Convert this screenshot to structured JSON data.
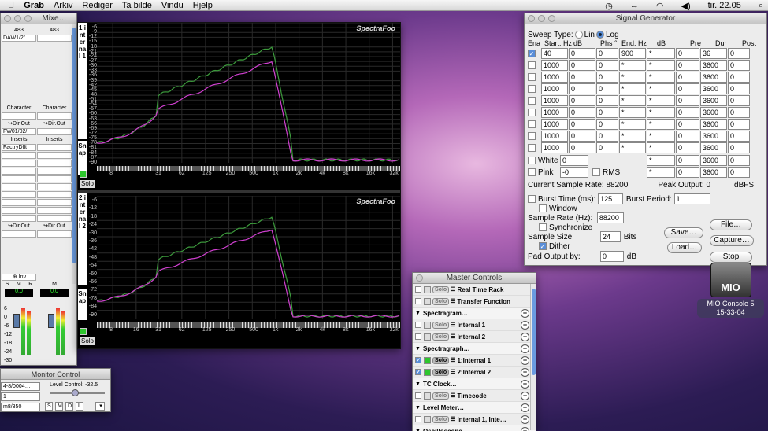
{
  "menubar": {
    "items": [
      "Grab",
      "Arkiv",
      "Rediger",
      "Ta bilde",
      "Vindu",
      "Hjelp"
    ],
    "clock": "tir. 22.05"
  },
  "mixer": {
    "title": "Mixe…",
    "ch1": {
      "id": "483",
      "sel": "DAW1/2/",
      "char_label": "Character",
      "dir": "↪Dir.Out",
      "dir_sel": "FW01/02/",
      "ins_label": "Inserts",
      "ins_sel": "FactryDflt",
      "dir2": "↪Dir.Out",
      "inv": "⊕ Inv",
      "smr": [
        "S",
        "M",
        "R"
      ],
      "val": "0.0"
    },
    "ch2": {
      "id": "483",
      "char_label": "Character",
      "dir": "↪Dir.Out",
      "ins_label": "Inserts",
      "dir2": "↪Dir.Out",
      "m": "M",
      "val": "0.0"
    },
    "scale": [
      "6",
      "0",
      "-6",
      "-12",
      "-18",
      "-24",
      "-30"
    ]
  },
  "spectra": {
    "brand": "SpectraFoo",
    "panels": [
      {
        "vlabel": "1 internal 1",
        "snap": "Snap",
        "solo": "Solo",
        "y": [
          "-6",
          "-9",
          "-12",
          "-15",
          "-18",
          "-21",
          "-24",
          "-27",
          "-30",
          "-33",
          "-36",
          "-39",
          "-42",
          "-45",
          "-48",
          "-51",
          "-54",
          "-57",
          "-60",
          "-63",
          "-66",
          "-69",
          "-72",
          "-75",
          "-78",
          "-81",
          "-84",
          "-87",
          "-90"
        ],
        "x": [
          "8",
          "31",
          "62",
          "125",
          "250",
          "500",
          "1k",
          "2k",
          "4k",
          "8k",
          "16k",
          "32k"
        ]
      },
      {
        "vlabel": "2 internal 2",
        "snap": "Snap",
        "solo": "Solo",
        "y": [
          "-6",
          "-12",
          "-18",
          "-24",
          "-30",
          "-36",
          "-42",
          "-48",
          "-54",
          "-60",
          "-66",
          "-72",
          "-78",
          "-84",
          "-90"
        ],
        "x": [
          "8",
          "16",
          "31",
          "62",
          "125",
          "250",
          "500",
          "1k",
          "2k",
          "4k",
          "8k",
          "16k",
          "32k"
        ]
      }
    ]
  },
  "siggen": {
    "title": "Signal Generator",
    "sweep_label": "Sweep Type:",
    "lin": "Lin",
    "log": "Log",
    "headers": [
      "Ena",
      "Start: Hz",
      "dB",
      "Phs °",
      "End: Hz",
      "dB",
      "Pre",
      "Dur",
      "Post"
    ],
    "rows": [
      {
        "on": true,
        "start": "40",
        "db": "0",
        "phs": "0",
        "end": "900",
        "edb": "*",
        "pre": "0",
        "dur": "36",
        "post": "0"
      },
      {
        "on": false,
        "start": "1000",
        "db": "0",
        "phs": "0",
        "end": "*",
        "edb": "*",
        "pre": "0",
        "dur": "3600",
        "post": "0"
      },
      {
        "on": false,
        "start": "1000",
        "db": "0",
        "phs": "0",
        "end": "*",
        "edb": "*",
        "pre": "0",
        "dur": "3600",
        "post": "0"
      },
      {
        "on": false,
        "start": "1000",
        "db": "0",
        "phs": "0",
        "end": "*",
        "edb": "*",
        "pre": "0",
        "dur": "3600",
        "post": "0"
      },
      {
        "on": false,
        "start": "1000",
        "db": "0",
        "phs": "0",
        "end": "*",
        "edb": "*",
        "pre": "0",
        "dur": "3600",
        "post": "0"
      },
      {
        "on": false,
        "start": "1000",
        "db": "0",
        "phs": "0",
        "end": "*",
        "edb": "*",
        "pre": "0",
        "dur": "3600",
        "post": "0"
      },
      {
        "on": false,
        "start": "1000",
        "db": "0",
        "phs": "0",
        "end": "*",
        "edb": "*",
        "pre": "0",
        "dur": "3600",
        "post": "0"
      },
      {
        "on": false,
        "start": "1000",
        "db": "0",
        "phs": "0",
        "end": "*",
        "edb": "*",
        "pre": "0",
        "dur": "3600",
        "post": "0"
      },
      {
        "on": false,
        "start": "1000",
        "db": "0",
        "phs": "0",
        "end": "*",
        "edb": "*",
        "pre": "0",
        "dur": "3600",
        "post": "0"
      }
    ],
    "white": {
      "label": "White",
      "db": "0",
      "edb": "*",
      "pre": "0",
      "dur": "3600",
      "post": "0"
    },
    "pink": {
      "label": "Pink",
      "db": "-0",
      "rms": "RMS",
      "edb": "*",
      "pre": "0",
      "dur": "3600",
      "post": "0"
    },
    "csr_label": "Current Sample Rate:",
    "csr": "88200",
    "peak_label": "Peak Output:",
    "peak": "0",
    "dbfs": "dBFS",
    "burst_label": "Burst Time (ms):",
    "burst": "125",
    "period_label": "Burst Period:",
    "period": "1",
    "window": "Window",
    "sr_label": "Sample Rate (Hz):",
    "sr": "88200",
    "sync": "Synchronize",
    "ss_label": "Sample Size:",
    "ss": "24",
    "bits": "Bits",
    "dither": "Dither",
    "pad_label": "Pad Output by:",
    "pad": "0",
    "db": "dB",
    "buttons": {
      "file": "File…",
      "save": "Save…",
      "capture": "Capture…",
      "load": "Load…",
      "stop": "Stop"
    }
  },
  "master": {
    "title": "Master Controls",
    "rows": [
      {
        "type": "item",
        "label": "Real Time Rack",
        "solo": false
      },
      {
        "type": "item",
        "label": "Transfer Function",
        "solo": false,
        "sel": true
      },
      {
        "type": "cat",
        "label": "Spectragram…",
        "pm": "+"
      },
      {
        "type": "item",
        "label": "Internal 1",
        "pm": "−"
      },
      {
        "type": "item",
        "label": "Internal 2",
        "pm": "−"
      },
      {
        "type": "cat",
        "label": "Spectragraph…",
        "pm": "+"
      },
      {
        "type": "item",
        "label": "1:Internal 1",
        "on": true,
        "pm": "−"
      },
      {
        "type": "item",
        "label": "2:Internal 2",
        "on": true,
        "pm": "−"
      },
      {
        "type": "cat",
        "label": "TC Clock…",
        "pm": "+"
      },
      {
        "type": "item",
        "label": "Timecode",
        "pm": "−"
      },
      {
        "type": "cat",
        "label": "Level Meter…",
        "pm": "+"
      },
      {
        "type": "item",
        "label": "Internal 1, Inte…",
        "pm": "−"
      },
      {
        "type": "cat",
        "label": "Oscilloscope…",
        "pm": "+"
      }
    ],
    "solo": "Solo"
  },
  "monitor": {
    "title": "Monitor Control",
    "src1": "4-8/0004…",
    "src2": "1",
    "src3": "m8/350",
    "level_label": "Level Control:",
    "level": "-32.5",
    "btns": [
      "S",
      "M",
      "D",
      "L"
    ]
  },
  "mio": {
    "icon": "MIO",
    "line1": "MIO Console 5",
    "line2": "15-33-04"
  }
}
